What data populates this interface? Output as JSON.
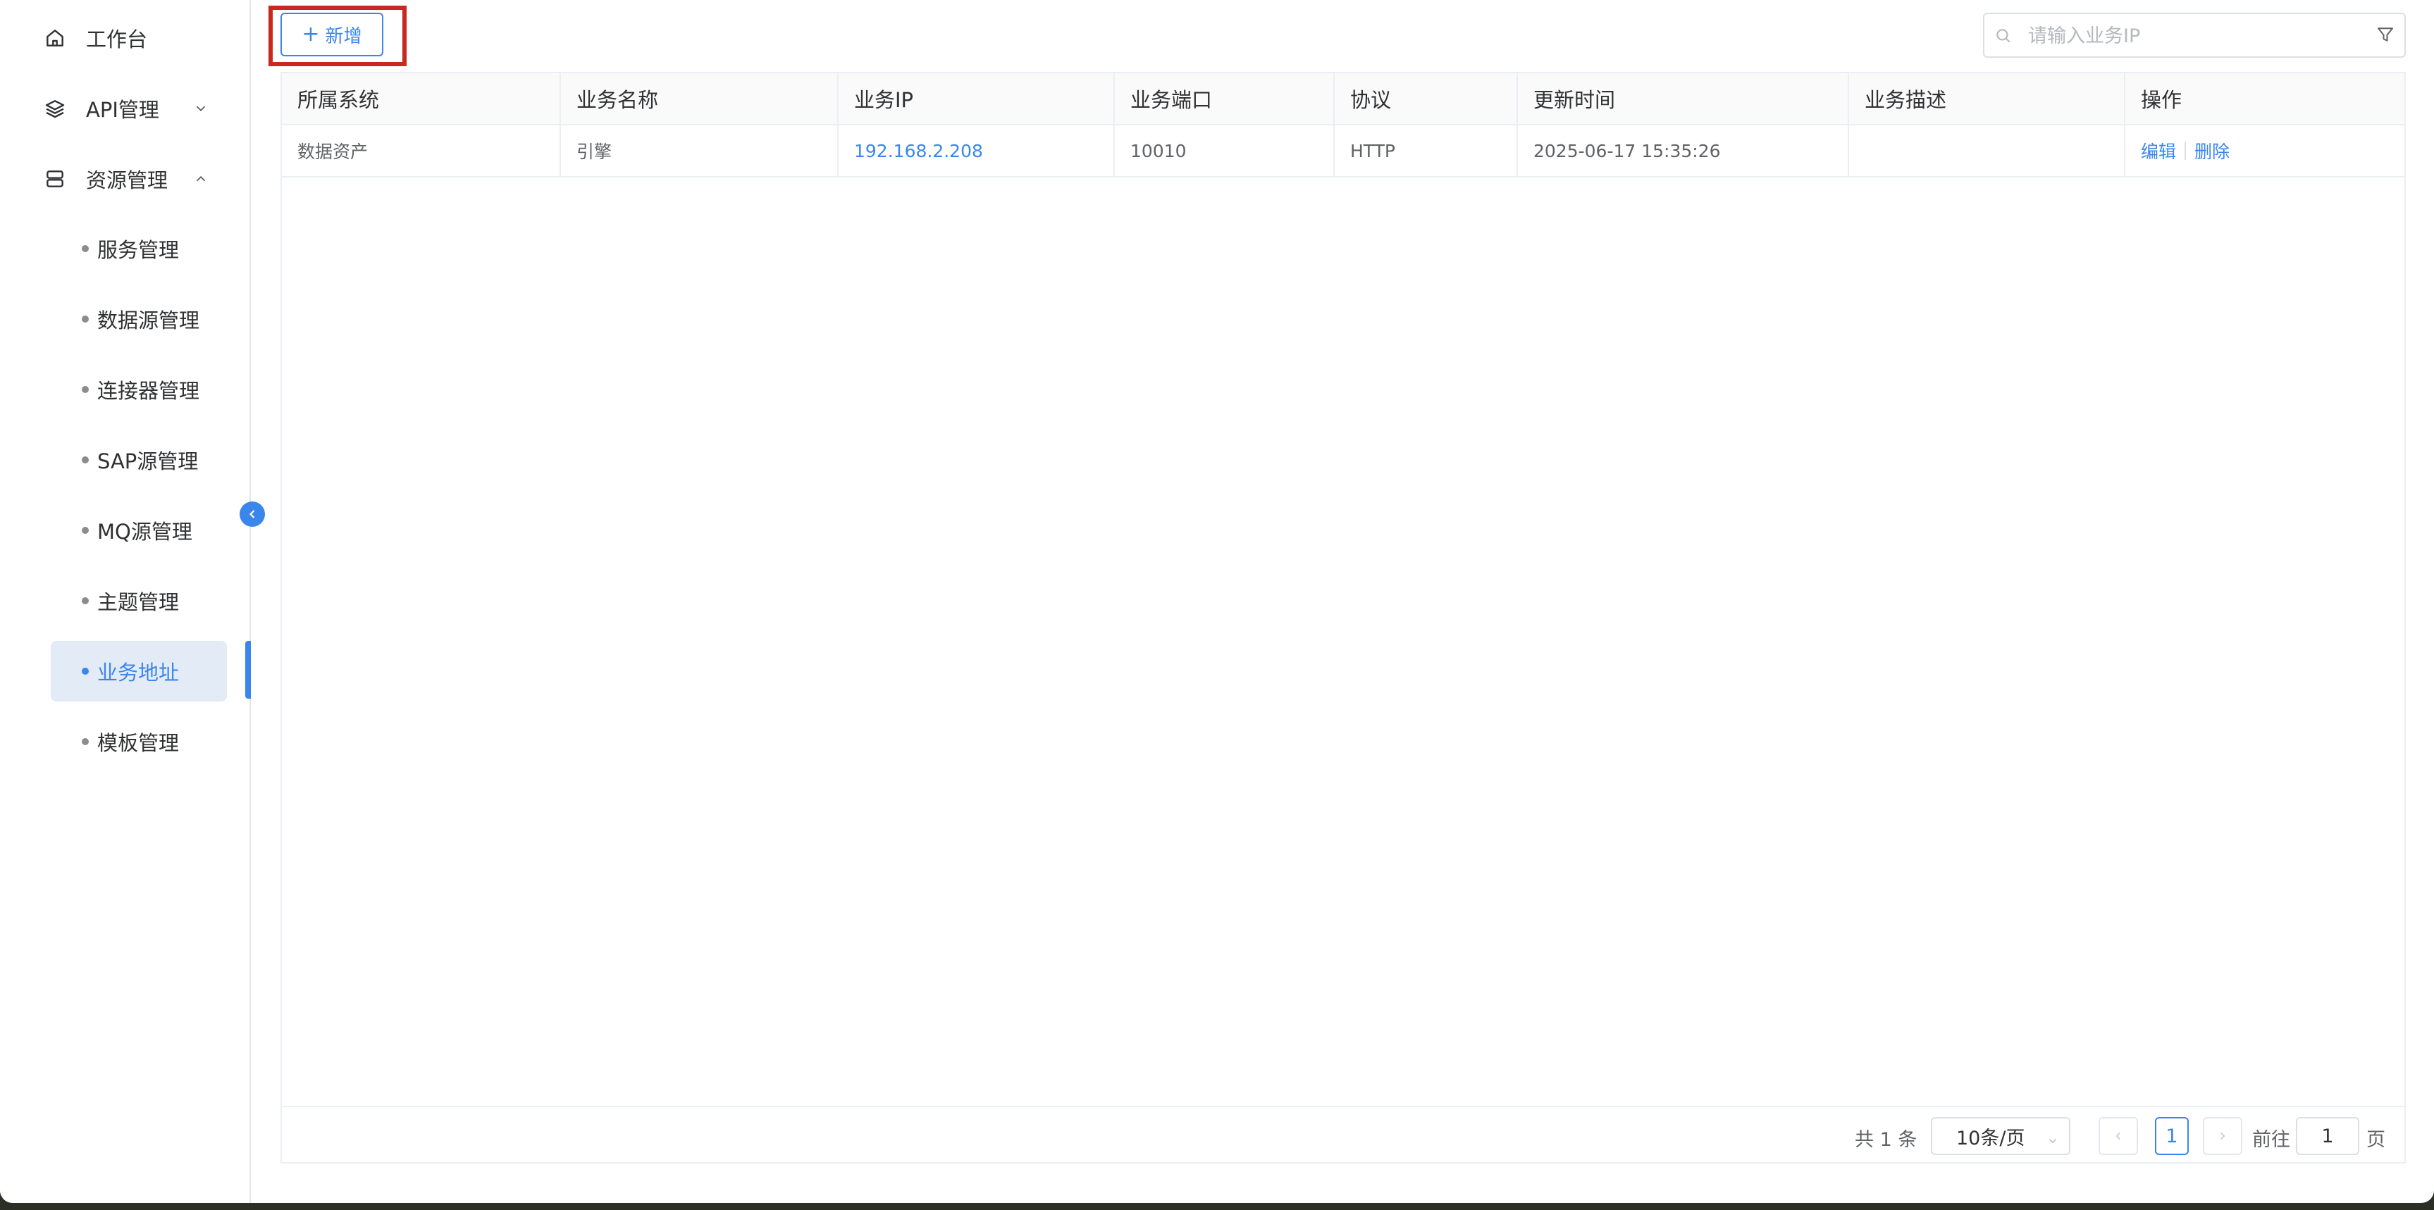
{
  "sidebar": {
    "workbench": "工作台",
    "api": "API管理",
    "resource": "资源管理",
    "items": [
      {
        "label": "服务管理"
      },
      {
        "label": "数据源管理"
      },
      {
        "label": "连接器管理"
      },
      {
        "label": "SAP源管理"
      },
      {
        "label": "MQ源管理"
      },
      {
        "label": "主题管理"
      },
      {
        "label": "业务地址"
      },
      {
        "label": "模板管理"
      }
    ],
    "active_item": "业务地址"
  },
  "toolbar": {
    "add_label": "新增",
    "search_placeholder": "请输入业务IP",
    "icons": [
      "plus-icon",
      "search-icon",
      "filter-icon"
    ]
  },
  "table": {
    "columns": [
      "所属系统",
      "业务名称",
      "业务IP",
      "业务端口",
      "协议",
      "更新时间",
      "业务描述",
      "操作"
    ],
    "rows": [
      {
        "system": "数据资产",
        "name": "引擎",
        "ip": "192.168.2.208",
        "port": "10010",
        "protocol": "HTTP",
        "updated": "2025-06-17 15:35:26",
        "desc": "",
        "edit": "编辑",
        "delete": "删除"
      }
    ]
  },
  "pagination": {
    "total": "共 1 条",
    "page_size": "10条/页",
    "current_page": "1",
    "goto_label": "前往",
    "goto_value": "1",
    "page_suffix": "页"
  },
  "colors": {
    "accent": "#3a86ea",
    "highlight_box": "#c8281f",
    "active_bg": "#e3ebf7"
  }
}
